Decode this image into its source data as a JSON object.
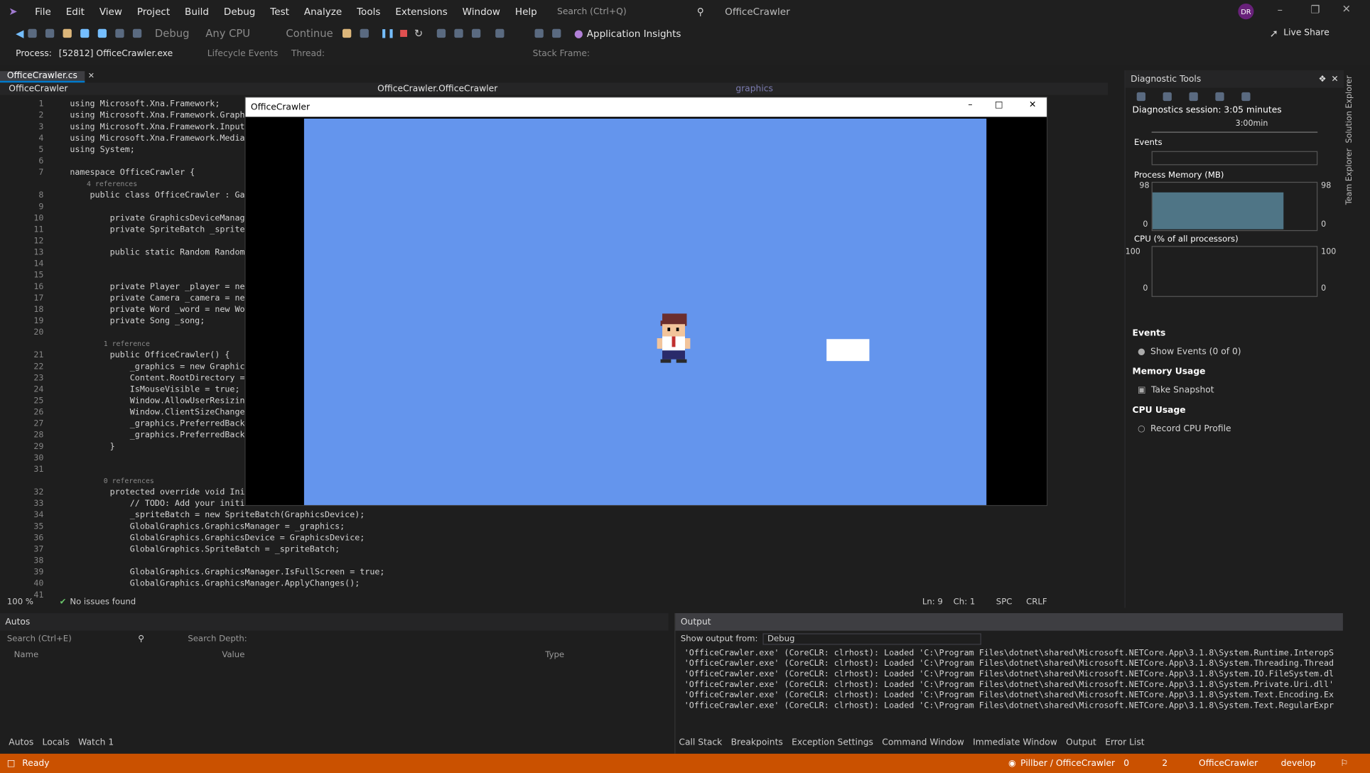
{
  "menubar": {
    "items": [
      "File",
      "Edit",
      "View",
      "Project",
      "Build",
      "Debug",
      "Test",
      "Analyze",
      "Tools",
      "Extensions",
      "Window",
      "Help"
    ],
    "search_placeholder": "Search (Ctrl+Q)",
    "solution_name": "OfficeCrawler",
    "avatar": "DR"
  },
  "toolbar": {
    "config": "Debug",
    "platform": "Any CPU",
    "continue": "Continue",
    "insights": "Application Insights",
    "live_share": "Live Share",
    "process_label": "Process:",
    "process_value": "[52812] OfficeCrawler.exe",
    "lifecycle": "Lifecycle Events",
    "thread": "Thread:",
    "stack": "Stack Frame:"
  },
  "editor": {
    "tab": "OfficeCrawler.cs",
    "nav_left": "OfficeCrawler",
    "nav_mid": "OfficeCrawler.OfficeCrawler",
    "nav_right": "graphics",
    "lines": [
      {
        "n": "1",
        "t": "using Microsoft.Xna.Framework;"
      },
      {
        "n": "2",
        "t": "using Microsoft.Xna.Framework.Graph"
      },
      {
        "n": "3",
        "t": "using Microsoft.Xna.Framework.Input"
      },
      {
        "n": "4",
        "t": "using Microsoft.Xna.Framework.Media"
      },
      {
        "n": "5",
        "t": "using System;"
      },
      {
        "n": "6",
        "t": ""
      },
      {
        "n": "7",
        "t": "namespace OfficeCrawler {"
      },
      {
        "n": "",
        "t": "    4 references"
      },
      {
        "n": "8",
        "t": "    public class OfficeCrawler : Ga"
      },
      {
        "n": "9",
        "t": ""
      },
      {
        "n": "10",
        "t": "        private GraphicsDeviceManag"
      },
      {
        "n": "11",
        "t": "        private SpriteBatch _sprite"
      },
      {
        "n": "12",
        "t": ""
      },
      {
        "n": "13",
        "t": "        public static Random Random"
      },
      {
        "n": "14",
        "t": ""
      },
      {
        "n": "15",
        "t": ""
      },
      {
        "n": "16",
        "t": "        private Player _player = ne"
      },
      {
        "n": "17",
        "t": "        private Camera _camera = ne"
      },
      {
        "n": "18",
        "t": "        private Word _word = new Wo"
      },
      {
        "n": "19",
        "t": "        private Song _song;"
      },
      {
        "n": "20",
        "t": ""
      },
      {
        "n": "",
        "t": "        1 reference"
      },
      {
        "n": "21",
        "t": "        public OfficeCrawler() {"
      },
      {
        "n": "22",
        "t": "            _graphics = new Graphic"
      },
      {
        "n": "23",
        "t": "            Content.RootDirectory ="
      },
      {
        "n": "24",
        "t": "            IsMouseVisible = true;"
      },
      {
        "n": "25",
        "t": "            Window.AllowUserResizin"
      },
      {
        "n": "26",
        "t": "            Window.ClientSizeChange"
      },
      {
        "n": "27",
        "t": "            _graphics.PreferredBack"
      },
      {
        "n": "28",
        "t": "            _graphics.PreferredBack"
      },
      {
        "n": "29",
        "t": "        }"
      },
      {
        "n": "30",
        "t": ""
      },
      {
        "n": "31",
        "t": ""
      },
      {
        "n": "",
        "t": "        0 references"
      },
      {
        "n": "32",
        "t": "        protected override void Ini"
      },
      {
        "n": "33",
        "t": "            // TODO: Add your initi"
      },
      {
        "n": "34",
        "t": "            _spriteBatch = new SpriteBatch(GraphicsDevice);"
      },
      {
        "n": "35",
        "t": "            GlobalGraphics.GraphicsManager = _graphics;"
      },
      {
        "n": "36",
        "t": "            GlobalGraphics.GraphicsDevice = GraphicsDevice;"
      },
      {
        "n": "37",
        "t": "            GlobalGraphics.SpriteBatch = _spriteBatch;"
      },
      {
        "n": "38",
        "t": ""
      },
      {
        "n": "39",
        "t": "            GlobalGraphics.GraphicsManager.IsFullScreen = true;"
      },
      {
        "n": "40",
        "t": "            GlobalGraphics.GraphicsManager.ApplyChanges();"
      },
      {
        "n": "41",
        "t": ""
      }
    ],
    "zoom": "100 %",
    "issues": "No issues found",
    "ln": "Ln: 9",
    "ch": "Ch: 1",
    "spc": "SPC",
    "crlf": "CRLF"
  },
  "game": {
    "title": "OfficeCrawler"
  },
  "diagnostics": {
    "title": "Diagnostic Tools",
    "session": "Diagnostics session: 3:05 minutes",
    "timeline": "3:00min",
    "events_header": "Events",
    "memory_header": "Process Memory (MB)",
    "mem_max": "98",
    "mem_min": "0",
    "cpu_header": "CPU (% of all processors)",
    "cpu_max": "100",
    "cpu_min": "0",
    "events_section": "Events",
    "show_events": "Show Events (0 of 0)",
    "memory_usage": "Memory Usage",
    "take_snapshot": "Take Snapshot",
    "cpu_usage": "CPU Usage",
    "record_cpu": "Record CPU Profile"
  },
  "side_tabs": [
    "Solution Explorer",
    "Team Explorer"
  ],
  "autos": {
    "title": "Autos",
    "search": "Search (Ctrl+E)",
    "search_depth": "Search Depth:",
    "col_name": "Name",
    "col_value": "Value",
    "col_type": "Type",
    "tabs": [
      "Autos",
      "Locals",
      "Watch 1"
    ]
  },
  "output": {
    "title": "Output",
    "show_from": "Show output from:",
    "source": "Debug",
    "lines": [
      "'OfficeCrawler.exe' (CoreCLR: clrhost): Loaded 'C:\\Program Files\\dotnet\\shared\\Microsoft.NETCore.App\\3.1.8\\System.Runtime.InteropS",
      "'OfficeCrawler.exe' (CoreCLR: clrhost): Loaded 'C:\\Program Files\\dotnet\\shared\\Microsoft.NETCore.App\\3.1.8\\System.Threading.Thread",
      "'OfficeCrawler.exe' (CoreCLR: clrhost): Loaded 'C:\\Program Files\\dotnet\\shared\\Microsoft.NETCore.App\\3.1.8\\System.IO.FileSystem.dl",
      "'OfficeCrawler.exe' (CoreCLR: clrhost): Loaded 'C:\\Program Files\\dotnet\\shared\\Microsoft.NETCore.App\\3.1.8\\System.Private.Uri.dll'",
      "'OfficeCrawler.exe' (CoreCLR: clrhost): Loaded 'C:\\Program Files\\dotnet\\shared\\Microsoft.NETCore.App\\3.1.8\\System.Text.Encoding.Ex",
      "'OfficeCrawler.exe' (CoreCLR: clrhost): Loaded 'C:\\Program Files\\dotnet\\shared\\Microsoft.NETCore.App\\3.1.8\\System.Text.RegularExpr"
    ],
    "tabs": [
      "Call Stack",
      "Breakpoints",
      "Exception Settings",
      "Command Window",
      "Immediate Window",
      "Output",
      "Error List"
    ]
  },
  "status": {
    "ready": "Ready",
    "repo": "Pillber / OfficeCrawler",
    "up": "0",
    "edits": "2",
    "project": "OfficeCrawler",
    "branch": "develop"
  },
  "colors": {
    "status_bar": "#ca5100",
    "game_bg": "#6495ed"
  }
}
